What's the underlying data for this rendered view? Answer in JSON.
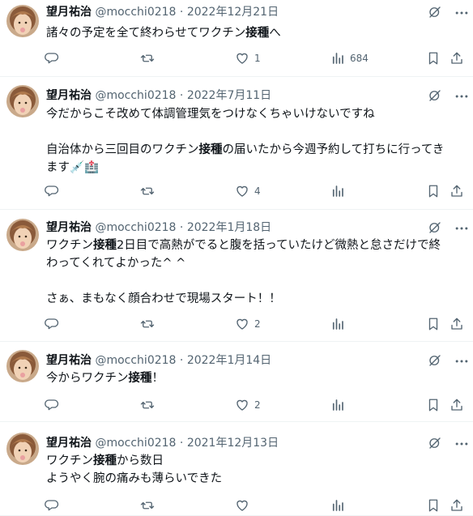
{
  "user": {
    "name": "望月祐治",
    "handle": "@mocchi0218"
  },
  "tweets": [
    {
      "date": "2022年12月21日",
      "lines": [
        [
          {
            "t": "諸々の予定を全て終わらせてワクチン"
          },
          {
            "t": "接種",
            "b": true
          },
          {
            "t": "へ"
          }
        ]
      ],
      "like": "1",
      "views": "684"
    },
    {
      "date": "2022年7月11日",
      "lines": [
        [
          {
            "t": "今だからこそ改めて体調管理気をつけなくちゃいけないですね"
          }
        ],
        [],
        [
          {
            "t": "自治体から三回目のワクチン"
          },
          {
            "t": "接種",
            "b": true
          },
          {
            "t": "の届いたから今週予約して打ちに行ってき"
          }
        ],
        [
          {
            "t": "ます💉🏥"
          }
        ]
      ],
      "like": "4",
      "views": ""
    },
    {
      "date": "2022年1月18日",
      "lines": [
        [
          {
            "t": "ワクチン"
          },
          {
            "t": "接種",
            "b": true
          },
          {
            "t": "2日目で高熱がでると腹を括っていたけど微熱と怠さだけで終"
          }
        ],
        [
          {
            "t": "わってくれてよかった^ ^"
          }
        ],
        [],
        [
          {
            "t": "さぁ、まもなく顔合わせで現場スタート！！"
          }
        ]
      ],
      "like": "2",
      "views": ""
    },
    {
      "date": "2022年1月14日",
      "lines": [
        [
          {
            "t": "今からワクチン"
          },
          {
            "t": "接種",
            "b": true
          },
          {
            "t": "！"
          }
        ]
      ],
      "like": "2",
      "views": ""
    },
    {
      "date": "2021年12月13日",
      "lines": [
        [
          {
            "t": "ワクチン"
          },
          {
            "t": "接種",
            "b": true
          },
          {
            "t": "から数日"
          }
        ],
        [
          {
            "t": "ようやく腕の痛みも薄らいできた"
          }
        ]
      ],
      "like": "",
      "views": ""
    }
  ],
  "icons": [
    "reply-icon",
    "retweet-icon",
    "like-icon",
    "views-icon",
    "bookmark-icon",
    "share-icon",
    "grok-icon",
    "more-icon"
  ],
  "colors": {
    "text": "#0f1419",
    "secondary": "#536471",
    "divider": "#eff3f4"
  }
}
